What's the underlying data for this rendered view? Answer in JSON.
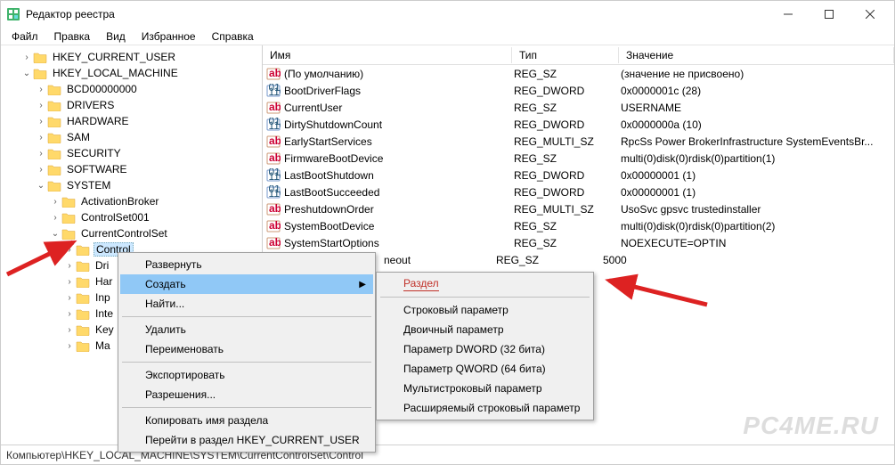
{
  "title": "Редактор реестра",
  "menubar": [
    "Файл",
    "Правка",
    "Вид",
    "Избранное",
    "Справка"
  ],
  "tree": {
    "hkcu": "HKEY_CURRENT_USER",
    "hklm": "HKEY_LOCAL_MACHINE",
    "nodes": [
      "BCD00000000",
      "DRIVERS",
      "HARDWARE",
      "SAM",
      "SECURITY",
      "SOFTWARE",
      "SYSTEM"
    ],
    "system_children": [
      "ActivationBroker",
      "ControlSet001",
      "CurrentControlSet"
    ],
    "ccs_sel": "Control",
    "ccs_rest": [
      "Dri",
      "Har",
      "Inp",
      "Inte",
      "Key",
      "Ma"
    ]
  },
  "columns": {
    "name": "Имя",
    "type": "Тип",
    "value": "Значение"
  },
  "values": [
    {
      "icon": "sz",
      "name": "(По умолчанию)",
      "type": "REG_SZ",
      "value": "(значение не присвоено)"
    },
    {
      "icon": "bin",
      "name": "BootDriverFlags",
      "type": "REG_DWORD",
      "value": "0x0000001c (28)"
    },
    {
      "icon": "sz",
      "name": "CurrentUser",
      "type": "REG_SZ",
      "value": "USERNAME"
    },
    {
      "icon": "bin",
      "name": "DirtyShutdownCount",
      "type": "REG_DWORD",
      "value": "0x0000000a (10)"
    },
    {
      "icon": "sz",
      "name": "EarlyStartServices",
      "type": "REG_MULTI_SZ",
      "value": "RpcSs Power BrokerInfrastructure SystemEventsBr..."
    },
    {
      "icon": "sz",
      "name": "FirmwareBootDevice",
      "type": "REG_SZ",
      "value": "multi(0)disk(0)rdisk(0)partition(1)"
    },
    {
      "icon": "bin",
      "name": "LastBootShutdown",
      "type": "REG_DWORD",
      "value": "0x00000001 (1)"
    },
    {
      "icon": "bin",
      "name": "LastBootSucceeded",
      "type": "REG_DWORD",
      "value": "0x00000001 (1)"
    },
    {
      "icon": "sz",
      "name": "PreshutdownOrder",
      "type": "REG_MULTI_SZ",
      "value": "UsoSvc gpsvc trustedinstaller"
    },
    {
      "icon": "sz",
      "name": "SystemBootDevice",
      "type": "REG_SZ",
      "value": "multi(0)disk(0)rdisk(0)partition(2)"
    },
    {
      "icon": "sz",
      "name": "SystemStartOptions",
      "type": "REG_SZ",
      "value": " NOEXECUTE=OPTIN"
    },
    {
      "icon": "sz",
      "name": "neout",
      "type": "REG_SZ",
      "value": "5000",
      "clipped": true
    }
  ],
  "ctx": {
    "expand": "Развернуть",
    "create": "Создать",
    "find": "Найти...",
    "delete": "Удалить",
    "rename": "Переименовать",
    "export": "Экспортировать",
    "perms": "Разрешения...",
    "copy": "Копировать имя раздела",
    "goto": "Перейти в раздел HKEY_CURRENT_USER"
  },
  "sub": {
    "key": "Раздел",
    "string": "Строковый параметр",
    "binary": "Двоичный параметр",
    "dword": "Параметр DWORD (32 бита)",
    "qword": "Параметр QWORD (64 бита)",
    "multi": "Мультистроковый параметр",
    "expand": "Расширяемый строковый параметр"
  },
  "statusbar": "Компьютер\\HKEY_LOCAL_MACHINE\\SYSTEM\\CurrentControlSet\\Control",
  "watermark": "PC4ME.RU"
}
